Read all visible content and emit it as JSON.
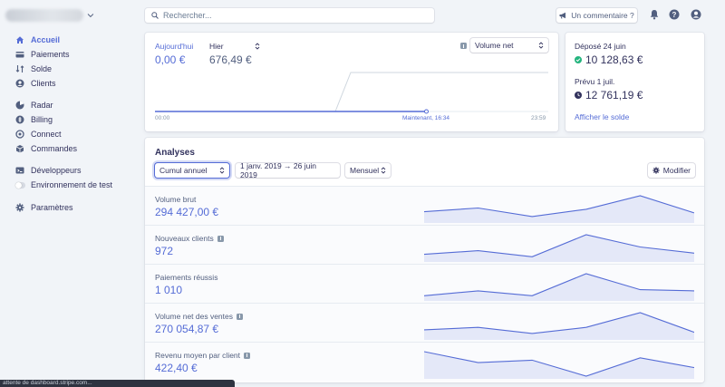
{
  "sidebar": {
    "nav": [
      {
        "label": "Accueil",
        "icon": "home-icon",
        "active": true
      },
      {
        "label": "Paiements",
        "icon": "payments-icon"
      },
      {
        "label": "Solde",
        "icon": "balance-icon"
      },
      {
        "label": "Clients",
        "icon": "customers-icon"
      },
      {
        "label": "Radar",
        "icon": "radar-icon"
      },
      {
        "label": "Billing",
        "icon": "billing-icon"
      },
      {
        "label": "Connect",
        "icon": "connect-icon"
      },
      {
        "label": "Commandes",
        "icon": "orders-icon"
      },
      {
        "label": "Développeurs",
        "icon": "developers-icon"
      },
      {
        "label": "Environnement de test",
        "icon": "toggle-icon"
      },
      {
        "label": "Paramètres",
        "icon": "gear-icon"
      }
    ]
  },
  "header": {
    "search_placeholder": "Rechercher...",
    "feedback_label": "Un commentaire ?"
  },
  "today": {
    "today_label": "Aujourd'hui",
    "today_value": "0,00 €",
    "compare_label": "Hier",
    "compare_value": "676,49 €",
    "metric_select": "Volume net",
    "axis_start": "00:00",
    "axis_now": "Maintenant, 16:34",
    "axis_end": "23:59",
    "now_fraction": 0.69
  },
  "balance": {
    "deposited_label": "Déposé 24 juin",
    "deposited_value": "10 128,63 €",
    "expected_label": "Prévu 1 juil.",
    "expected_value": "12 761,19 €",
    "link": "Afficher le solde"
  },
  "analyses": {
    "title": "Analyses",
    "period_select": "Cumul annuel",
    "date_range": "1 janv. 2019 → 26 juin 2019",
    "interval_select": "Mensuel",
    "edit_button": "Modifier",
    "rows": [
      {
        "label": "Volume brut",
        "value": "294 427,00 €",
        "info": false,
        "trend": [
          0.35,
          0.5,
          0.15,
          0.45,
          1.0,
          0.3
        ]
      },
      {
        "label": "Nouveaux clients",
        "value": "972",
        "info": true,
        "trend": [
          0.2,
          0.35,
          0.1,
          1.0,
          0.5,
          0.25
        ]
      },
      {
        "label": "Paiements réussis",
        "value": "1 010",
        "info": false,
        "trend": [
          0.1,
          0.3,
          0.1,
          1.0,
          0.35,
          0.3
        ]
      },
      {
        "label": "Volume net des ventes",
        "value": "270 054,87 €",
        "info": true,
        "trend": [
          0.3,
          0.4,
          0.15,
          0.4,
          1.0,
          0.2
        ]
      },
      {
        "label": "Revenu moyen par client",
        "value": "422,40 €",
        "info": true,
        "trend": [
          1.0,
          0.55,
          0.65,
          0.0,
          0.75,
          0.35
        ]
      }
    ]
  },
  "statusbar": "attente de dashboard.stripe.com...",
  "colors": {
    "accent": "#556cd6",
    "success": "#24b47e",
    "text": "#32325d"
  }
}
